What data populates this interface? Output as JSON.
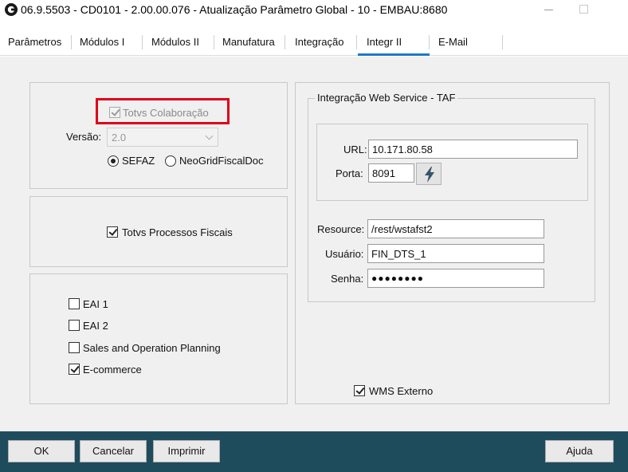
{
  "window": {
    "title": "06.9.5503 - CD0101 - 2.00.00.076 - Atualização Parâmetro Global - 10 - EMBAU:8680"
  },
  "tabs": [
    {
      "label": "Parâmetros"
    },
    {
      "label": "Módulos I"
    },
    {
      "label": "Módulos II"
    },
    {
      "label": "Manufatura"
    },
    {
      "label": "Integração"
    },
    {
      "label": "Integr II",
      "active": true
    },
    {
      "label": "E-Mail"
    }
  ],
  "colaboracao": {
    "checkbox_label": "Totvs Colaboração",
    "checked": true,
    "disabled": true,
    "versao_label": "Versão:",
    "versao_value": "2.0",
    "radio_sefaz": "SEFAZ",
    "radio_neogrid": "NeoGridFiscalDoc",
    "selected": "SEFAZ"
  },
  "processos": {
    "checkbox_label": "Totvs Processos Fiscais",
    "checked": true
  },
  "eai": {
    "items": [
      {
        "label": "EAI 1",
        "checked": false
      },
      {
        "label": "EAI 2",
        "checked": false
      },
      {
        "label": "Sales and Operation Planning",
        "checked": false
      },
      {
        "label": "E-commerce",
        "checked": true
      }
    ]
  },
  "taf": {
    "group_title": "Integração Web Service - TAF",
    "url_label": "URL:",
    "url_value": "10.171.80.58",
    "porta_label": "Porta:",
    "porta_value": "8091",
    "resource_label": "Resource:",
    "resource_value": "/rest/wstafst2",
    "usuario_label": "Usuário:",
    "usuario_value": "FIN_DTS_1",
    "senha_label": "Senha:",
    "senha_value": "●●●●●●●●"
  },
  "wms": {
    "checkbox_label": "WMS Externo",
    "checked": true
  },
  "footer": {
    "ok": "OK",
    "cancelar": "Cancelar",
    "imprimir": "Imprimir",
    "ajuda": "Ajuda"
  },
  "colors": {
    "footer_bg": "#1e4c5c",
    "tab_accent": "#1f77c8",
    "highlight": "#e0001a"
  }
}
